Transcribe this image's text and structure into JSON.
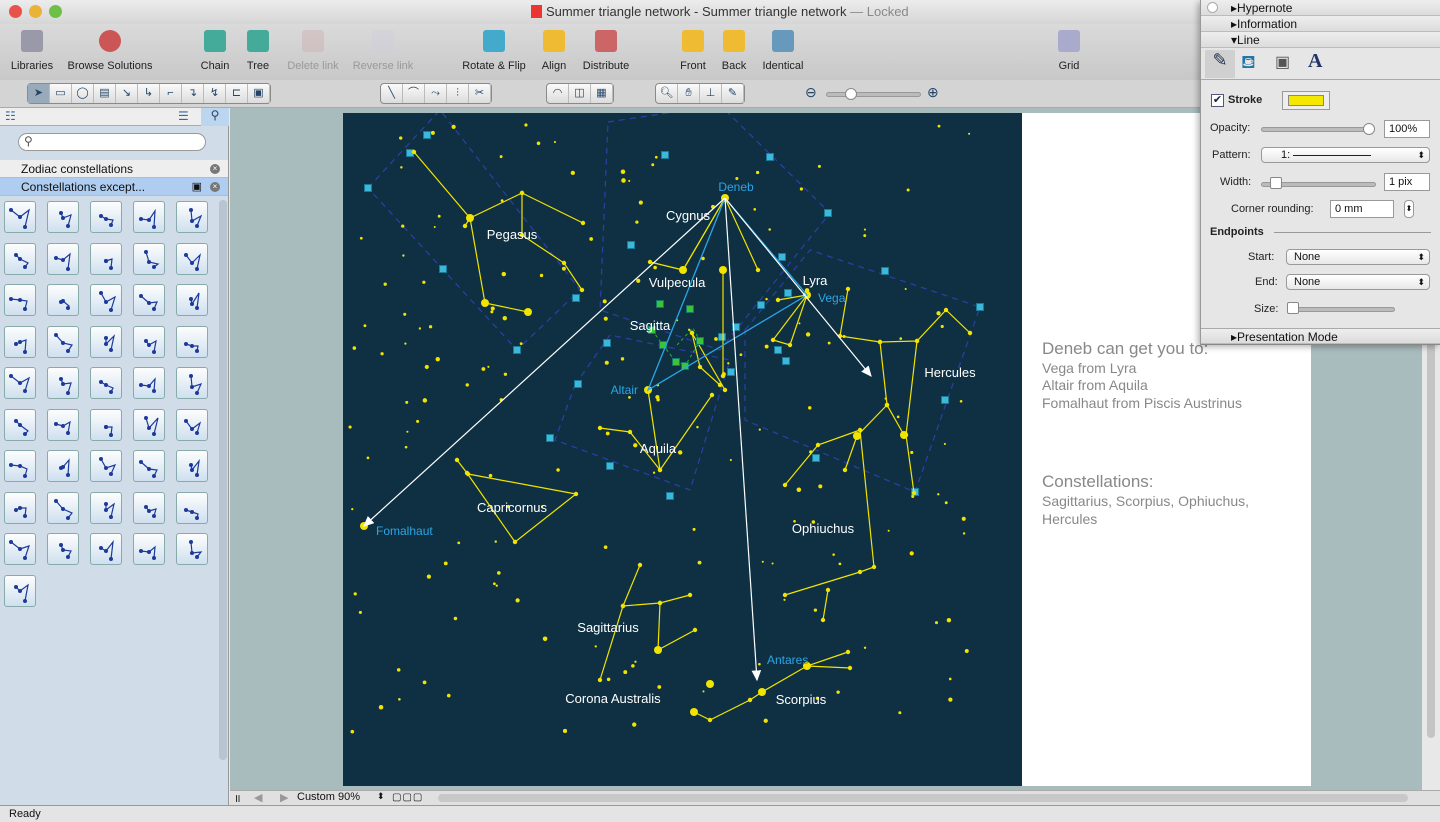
{
  "window": {
    "title": "Summer triangle network - Summer triangle network",
    "locked": "— Locked"
  },
  "toolbar": [
    {
      "label": "Libraries",
      "icon": "libraries-icon",
      "disabled": false
    },
    {
      "label": "Browse Solutions",
      "icon": "browse-solutions-icon",
      "disabled": false
    },
    {
      "label": "Chain",
      "icon": "chain-icon",
      "disabled": false
    },
    {
      "label": "Tree",
      "icon": "tree-icon",
      "disabled": false
    },
    {
      "label": "Delete link",
      "icon": "delete-link-icon",
      "disabled": true
    },
    {
      "label": "Reverse link",
      "icon": "reverse-link-icon",
      "disabled": true
    },
    {
      "label": "Rotate & Flip",
      "icon": "rotate-flip-icon",
      "disabled": false
    },
    {
      "label": "Align",
      "icon": "align-icon",
      "disabled": false
    },
    {
      "label": "Distribute",
      "icon": "distribute-icon",
      "disabled": false
    },
    {
      "label": "Front",
      "icon": "front-icon",
      "disabled": false
    },
    {
      "label": "Back",
      "icon": "back-icon",
      "disabled": false
    },
    {
      "label": "Identical",
      "icon": "identical-icon",
      "disabled": false
    },
    {
      "label": "Grid",
      "icon": "grid-icon",
      "disabled": false
    }
  ],
  "left_panel": {
    "search_placeholder": "",
    "libraries": [
      {
        "label": "Zodiac constellations",
        "selected": false
      },
      {
        "label": "Constellations except...",
        "selected": true
      }
    ]
  },
  "map": {
    "constellations": [
      "Pegasus",
      "Cygnus",
      "Vulpecula",
      "Sagitta",
      "Lyra",
      "Hercules",
      "Aquila",
      "Capricornus",
      "Ophiuchus",
      "Sagittarius",
      "Corona Australis",
      "Scorpius"
    ],
    "stars": [
      "Deneb",
      "Vega",
      "Altair",
      "Fomalhaut",
      "Antares"
    ],
    "colors": {
      "background": "#0e3042",
      "lines": "#f2e400",
      "star_labels": "#2aa6e8",
      "arrows": "#ffffff",
      "boundaries": "#2b3fa8"
    }
  },
  "notes": {
    "heading1": "Deneb can get you to:",
    "lines1": [
      "Vega from Lyra",
      "Altair from Aquila",
      "Fomalhaut from Piscis Austrinus"
    ],
    "heading2": "Constellations:",
    "lines2": [
      "Sagittarius, Scorpius, Ophiuchus,",
      "Hercules"
    ]
  },
  "inspector": {
    "sections": {
      "hypernote": "Hypernote",
      "information": "Information",
      "line": "Line",
      "presentation": "Presentation Mode"
    },
    "stroke_label": "Stroke",
    "stroke_checked": true,
    "stroke_color": "#f5e800",
    "opacity_label": "Opacity:",
    "opacity_value": "100%",
    "opacity": 1.0,
    "pattern_label": "Pattern:",
    "pattern_value": "1:",
    "width_label": "Width:",
    "width_value": "1 pix",
    "corner_label": "Corner rounding:",
    "corner_value": "0 mm",
    "endpoints_label": "Endpoints",
    "start_label": "Start:",
    "start_value": "None",
    "end_label": "End:",
    "end_value": "None",
    "size_label": "Size:"
  },
  "bottom": {
    "zoom": "Custom 90%"
  },
  "status": "Ready"
}
